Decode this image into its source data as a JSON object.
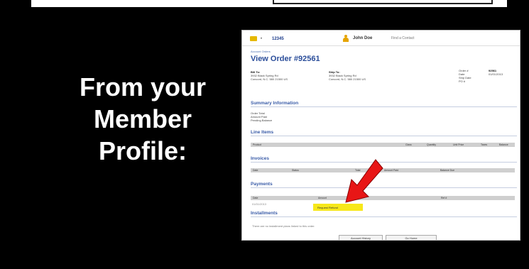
{
  "slide": {
    "lines": [
      "From your",
      "Member",
      "Profile:"
    ]
  },
  "screenshot": {
    "header": {
      "account_number": "12345",
      "user_name": "John Doe",
      "switch_link": "Find a Contact"
    },
    "breadcrumb": "Account Orders",
    "title": "View Order #92561",
    "bill_to": {
      "label": "Bill To:",
      "line1": "3932 Black Spring Rd",
      "line2": "Concord, N.C. 580 21500 US"
    },
    "ship_to": {
      "label": "Ship To:",
      "line1": "3932 Black Spring Rd",
      "line2": "Concord, N.C. 580 21500 US"
    },
    "order_meta": {
      "labels": [
        "Order #",
        "Date",
        "Ship Date",
        "PO #"
      ],
      "order_number": "92561",
      "order_date": "01/01/2013"
    },
    "summary": {
      "heading": "Summary Information",
      "rows": [
        "Order Total",
        "Amount Paid",
        "Pending Balance"
      ]
    },
    "line_items": {
      "heading": "Line Items",
      "columns": [
        "Product",
        "Class",
        "Quantity",
        "Unit Price",
        "Taxes",
        "Balance"
      ]
    },
    "invoices": {
      "heading": "Invoices",
      "columns": [
        "Date",
        "Status",
        "Total",
        "Amount Paid",
        "Balance Due"
      ]
    },
    "payments": {
      "heading": "Payments",
      "columns": [
        "Date",
        "Amount",
        "Ref #"
      ],
      "first_date": "01/01/2013",
      "highlight": "Request Refund"
    },
    "installments": {
      "heading": "Installments",
      "empty_text": "There are no installment plans linked to this order."
    },
    "buttons": {
      "history": "Account History",
      "close": "Go Home"
    }
  },
  "colors": {
    "highlight": "#f7e81a",
    "arrow": "#e81616",
    "link_blue": "#2a4d9a"
  }
}
